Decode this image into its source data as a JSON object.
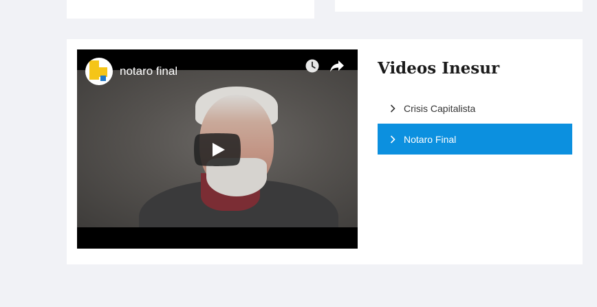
{
  "video": {
    "title": "notaro final",
    "icons": {
      "watch_later": "clock-icon",
      "share": "share-icon",
      "play": "play-icon",
      "channel": "channel-avatar"
    }
  },
  "sidebar": {
    "title": "Videos Inesur",
    "items": [
      {
        "label": "Crisis Capitalista",
        "active": false
      },
      {
        "label": "Notaro Final",
        "active": true
      }
    ]
  },
  "colors": {
    "page_background": "#f1f2f6",
    "card_background": "#ffffff",
    "active_item": "#0c90df",
    "youtube_red_play": "#212121"
  }
}
